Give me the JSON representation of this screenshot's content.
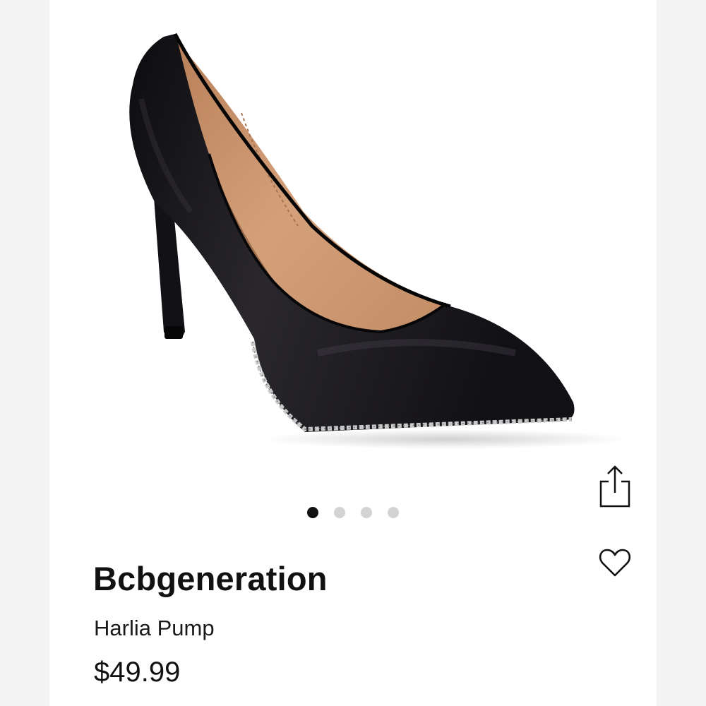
{
  "product": {
    "brand": "Bcbgeneration",
    "name": "Harlia Pump",
    "price": "$49.99"
  },
  "gallery": {
    "image_count": 4,
    "active_index": 0
  },
  "actions": {
    "share_icon": "share-icon",
    "favorite_icon": "heart-outline-icon"
  },
  "colors": {
    "shoe": "#141216",
    "lining": "#c9916a",
    "active_dot": "#111111",
    "inactive_dot": "#d3d3d3"
  }
}
